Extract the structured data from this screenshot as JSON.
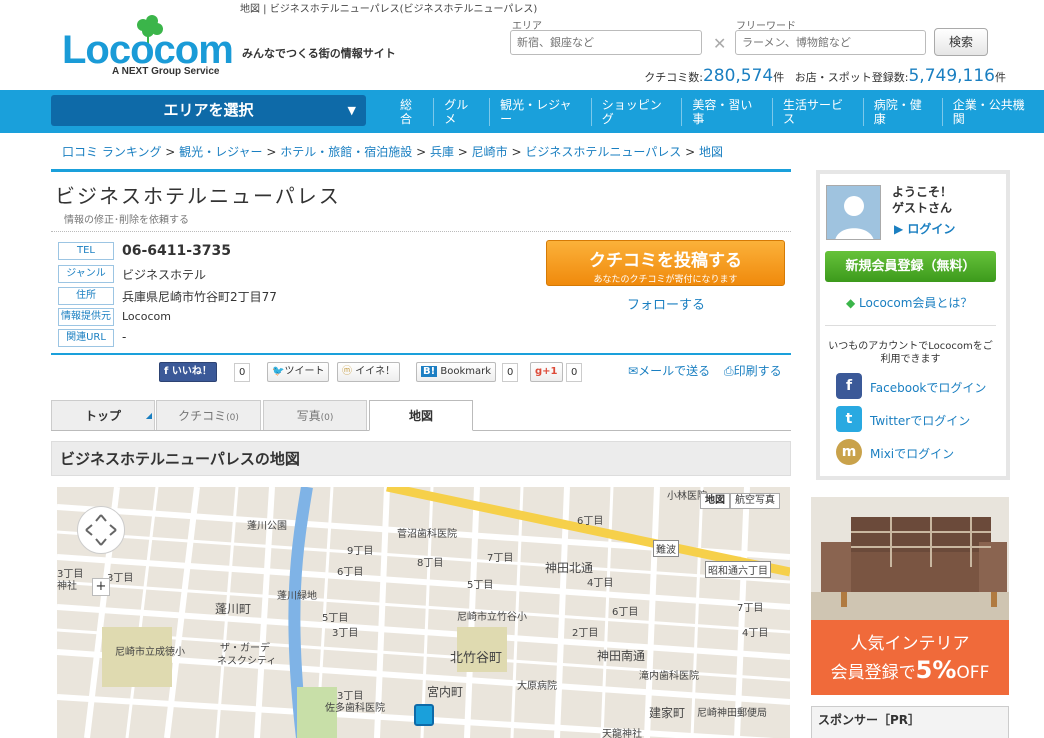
{
  "header": {
    "topline": "地図 | ビジネスホテルニューパレス(ビジネスホテルニューパレス)",
    "logo_text": "Lococom",
    "logo_sub": "A NEXT Group Service",
    "tagline": "みんなでつくる街の情報サイト",
    "area_label": "エリア",
    "area_placeholder": "新宿、銀座など",
    "keyword_label": "フリーワード",
    "keyword_placeholder": "ラーメン、博物館など",
    "search_button": "検索",
    "reviews_label": "クチコミ数:",
    "reviews_count": "280,574",
    "reviews_unit": "件",
    "spots_label": "お店・スポット登録数:",
    "spots_count": "5,749,116",
    "spots_unit": "件"
  },
  "nav": {
    "area_select": "エリアを選択",
    "items": [
      "総合",
      "グルメ",
      "観光・レジャー",
      "ショッピング",
      "美容・習い事",
      "生活サービス",
      "病院・健康",
      "企業・公共機関"
    ]
  },
  "breadcrumb": [
    "口コミ ランキング",
    "観光・レジャー",
    "ホテル・旅館・宿泊施設",
    "兵庫",
    "尼崎市",
    "ビジネスホテルニューパレス",
    "地図"
  ],
  "spot": {
    "title": "ビジネスホテルニューパレス",
    "fix_link": "情報の修正･削除を依頼する",
    "rows": [
      {
        "label": "TEL",
        "value": "06-6411-3735"
      },
      {
        "label": "ジャンル",
        "value": "ビジネスホテル"
      },
      {
        "label": "住所",
        "value": "兵庫県尼崎市竹谷町2丁目77"
      },
      {
        "label": "情報提供元",
        "value": "Lococom"
      },
      {
        "label": "関連URL",
        "value": "-"
      }
    ],
    "post_main": "クチコミを投稿する",
    "post_sub": "あなたのクチコミが寄付になります",
    "follow": "フォローする"
  },
  "social": {
    "like": "いいね！",
    "like_count": "0",
    "tweet": "ツイート",
    "mixi": "イイネ！",
    "bookmark": "Bookmark",
    "bookmark_count": "0",
    "gplus": "+1",
    "gplus_count": "0",
    "mail": "メールで送る",
    "print": "印刷する"
  },
  "tabs": [
    {
      "label": "トップ"
    },
    {
      "label": "クチコミ",
      "count": "(0)"
    },
    {
      "label": "写真",
      "count": "(0)"
    },
    {
      "label": "地図"
    }
  ],
  "map": {
    "heading": "ビジネスホテルニューパレスの地図",
    "btn_map": "地図",
    "btn_aerial": "航空写真",
    "labels": [
      "蓬川公園",
      "菅沼歯科医院",
      "9丁目",
      "8丁目",
      "7丁目",
      "3丁目",
      "6丁目",
      "6丁目",
      "5丁目",
      "4丁目",
      "神田北通",
      "蓬川緑地",
      "蓬川町",
      "尼崎市立竹谷小",
      "5丁目",
      "6丁目",
      "7丁目",
      "3丁目",
      "2丁目",
      "4丁目",
      "北竹谷町",
      "ザ・ガーデ",
      "ネスクシティ",
      "尼崎市立成徳小",
      "神田南通",
      "滝内歯科医院",
      "宮内町",
      "大原病院",
      "3丁目",
      "佐多歯科医院",
      "建家町",
      "尼崎神田郵便局",
      "天龍神社",
      "難波",
      "昭和通六丁目",
      "小林医院",
      "神社",
      "3丁目"
    ]
  },
  "sidebar": {
    "welcome": "ようこそ！",
    "guest": "ゲストさん",
    "login": "ログイン",
    "register": "新規会員登録（無料）",
    "what_is": "Lococom会員とは？",
    "account_text": "いつものアカウントでLococomをご利用できます",
    "facebook": "Facebookでログイン",
    "twitter": "Twitterでログイン",
    "mixi": "Mixiでログイン",
    "ad_line1": "人気インテリア",
    "ad_line2_pre": "会員登録で",
    "ad_line2_big": "5%",
    "ad_line2_post": "OFF",
    "sponsor": "スポンサー［PR］"
  }
}
